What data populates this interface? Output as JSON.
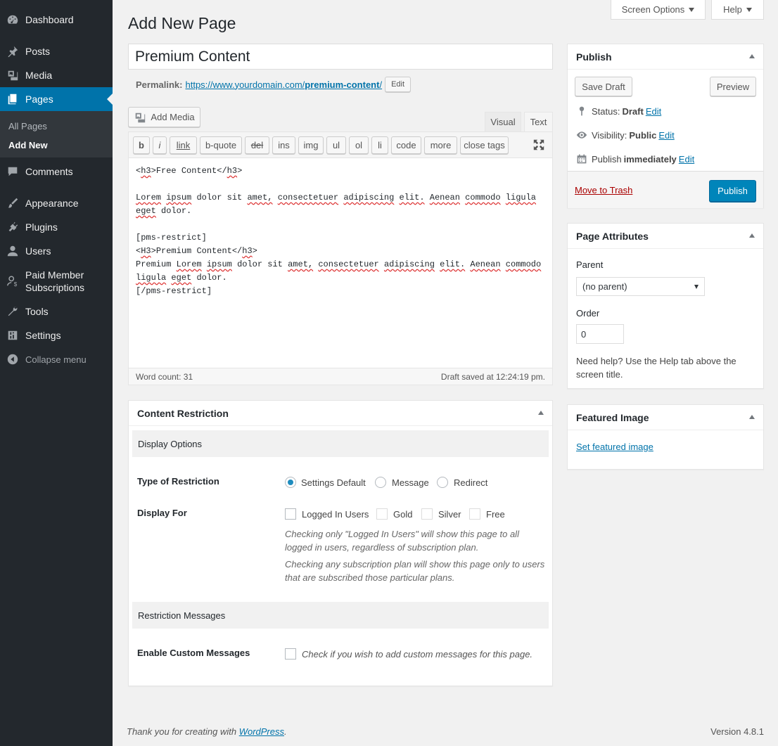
{
  "sidebar": {
    "items": [
      {
        "label": "Dashboard",
        "icon": "dashboard-icon"
      },
      {
        "label": "Posts",
        "icon": "pin-icon"
      },
      {
        "label": "Media",
        "icon": "media-icon"
      },
      {
        "label": "Pages",
        "icon": "pages-icon"
      },
      {
        "label": "Comments",
        "icon": "comment-icon"
      },
      {
        "label": "Appearance",
        "icon": "brush-icon"
      },
      {
        "label": "Plugins",
        "icon": "plugin-icon"
      },
      {
        "label": "Users",
        "icon": "user-icon"
      },
      {
        "label": "Paid Member Subscriptions",
        "icon": "user-dollar-icon"
      },
      {
        "label": "Tools",
        "icon": "wrench-icon"
      },
      {
        "label": "Settings",
        "icon": "settings-icon"
      },
      {
        "label": "Collapse menu",
        "icon": "collapse-icon"
      }
    ],
    "submenu": [
      "All Pages",
      "Add New"
    ]
  },
  "topbar": {
    "screen_options": "Screen Options",
    "help": "Help"
  },
  "page_title": "Add New Page",
  "post": {
    "title": "Premium Content",
    "permalink_label": "Permalink:",
    "permalink_base": "https://www.yourdomain.com/",
    "permalink_slug": "premium-content",
    "permalink_trailing": "/",
    "edit_label": "Edit"
  },
  "editor": {
    "add_media": "Add Media",
    "tabs": [
      "Visual",
      "Text"
    ],
    "active_tab": "Text",
    "quicktags": [
      "b",
      "i",
      "link",
      "b-quote",
      "del",
      "ins",
      "img",
      "ul",
      "ol",
      "li",
      "code",
      "more",
      "close tags"
    ],
    "content_lines": [
      "<h3>Free Content</h3>",
      "",
      "Lorem ipsum dolor sit amet, consectetuer adipiscing elit. Aenean commodo ligula",
      "eget dolor.",
      "",
      "[pms-restrict]",
      "<H3>Premium Content</h3>",
      "Premium Lorem ipsum dolor sit amet, consectetuer adipiscing elit. Aenean commodo",
      "ligula eget dolor.",
      "[/pms-restrict]"
    ],
    "word_count": "Word count: 31",
    "draft_saved": "Draft saved at 12:24:19 pm."
  },
  "publish": {
    "title": "Publish",
    "save_draft": "Save Draft",
    "preview": "Preview",
    "status_label": "Status:",
    "status_value": "Draft",
    "visibility_label": "Visibility:",
    "visibility_value": "Public",
    "publish_label": "Publish",
    "publish_value": "immediately",
    "edit": "Edit",
    "trash": "Move to Trash",
    "publish_button": "Publish"
  },
  "page_attributes": {
    "title": "Page Attributes",
    "parent_label": "Parent",
    "parent_value": "(no parent)",
    "order_label": "Order",
    "order_value": "0",
    "help_text": "Need help? Use the Help tab above the screen title."
  },
  "featured_image": {
    "title": "Featured Image",
    "link": "Set featured image"
  },
  "content_restriction": {
    "title": "Content Restriction",
    "display_options": "Display Options",
    "type_label": "Type of Restriction",
    "type_options": [
      "Settings Default",
      "Message",
      "Redirect"
    ],
    "type_selected": "Settings Default",
    "display_for_label": "Display For",
    "display_for_options": [
      "Logged In Users",
      "Gold",
      "Silver",
      "Free"
    ],
    "desc1": "Checking only \"Logged In Users\" will show this page to all logged in users, regardless of subscription plan.",
    "desc2": "Checking any subscription plan will show this page only to users that are subscribed those particular plans.",
    "restriction_messages": "Restriction Messages",
    "custom_label": "Enable Custom Messages",
    "custom_text": "Check if you wish to add custom messages for this page."
  },
  "footer": {
    "thanks": "Thank you for creating with ",
    "wp_link": "WordPress",
    "version": "Version 4.8.1"
  },
  "colors": {
    "accent": "#0073aa",
    "sidebar": "#23282d",
    "primary_button": "#0085ba",
    "trash": "#a00"
  }
}
